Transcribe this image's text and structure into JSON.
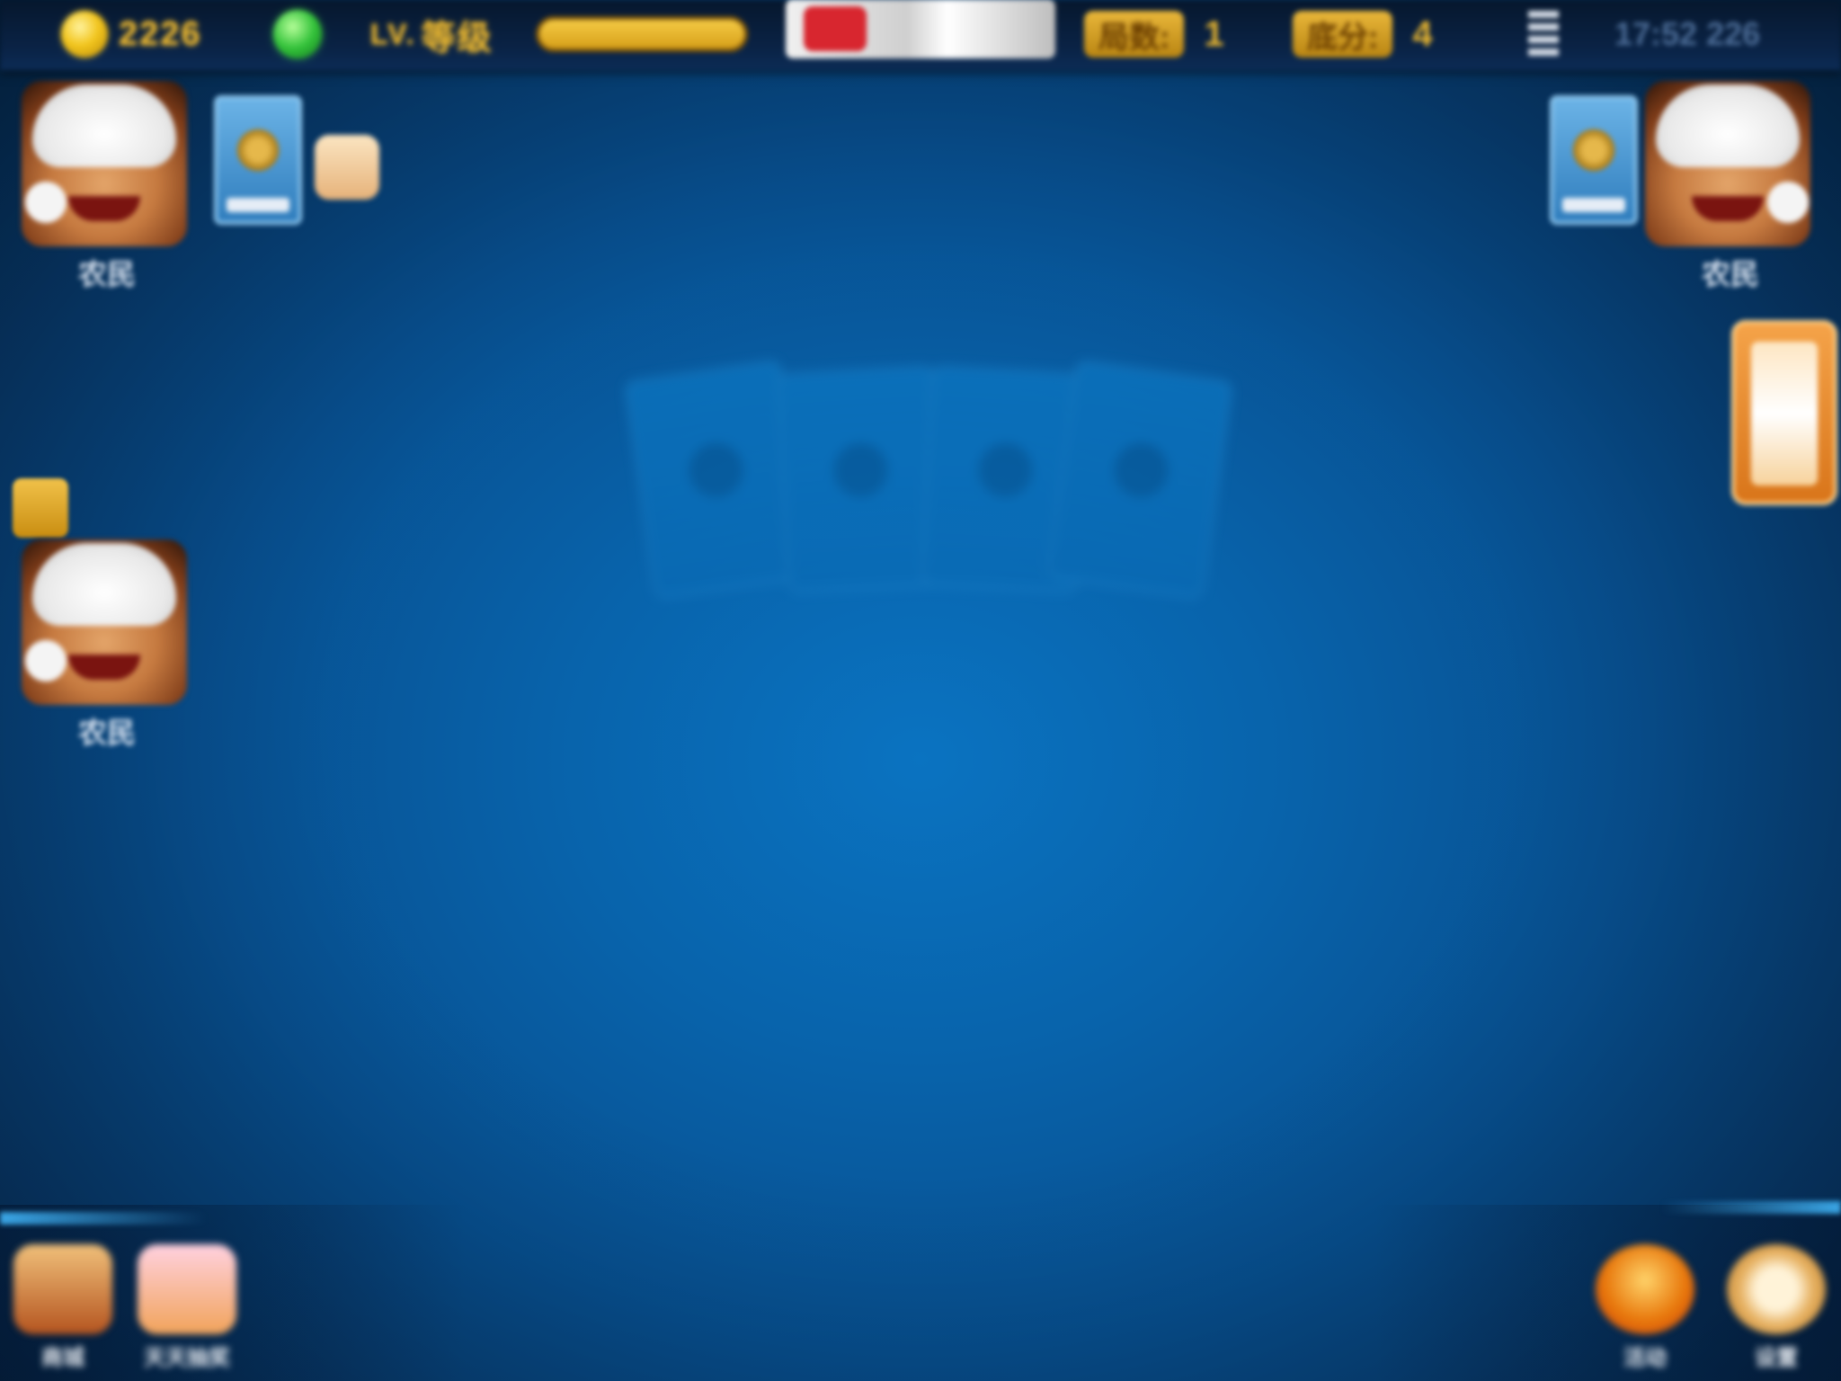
{
  "topbar": {
    "coins": "2226",
    "level_text": "LV.",
    "level_progress": 1.0,
    "round_label": "局数:",
    "round_value": "1",
    "score_label": "底分:",
    "score_value": "4",
    "clock": "17:52 226"
  },
  "players": {
    "top_left": {
      "name": "农民"
    },
    "middle_left": {
      "name": "农民"
    },
    "top_right": {
      "name": "农民"
    }
  },
  "table": {
    "watermark_labels": [
      "",
      "",
      ""
    ]
  },
  "bottom": {
    "left_buttons": [
      {
        "label": "商城",
        "icon": "shop-icon"
      },
      {
        "label": "天天抽奖",
        "icon": "gift-icon"
      }
    ],
    "right_buttons": [
      {
        "label": "活动",
        "icon": "lantern-icon"
      },
      {
        "label": "设置",
        "icon": "clock-icon"
      }
    ]
  },
  "side_tab": {
    "icon": "task-scroll-icon"
  }
}
